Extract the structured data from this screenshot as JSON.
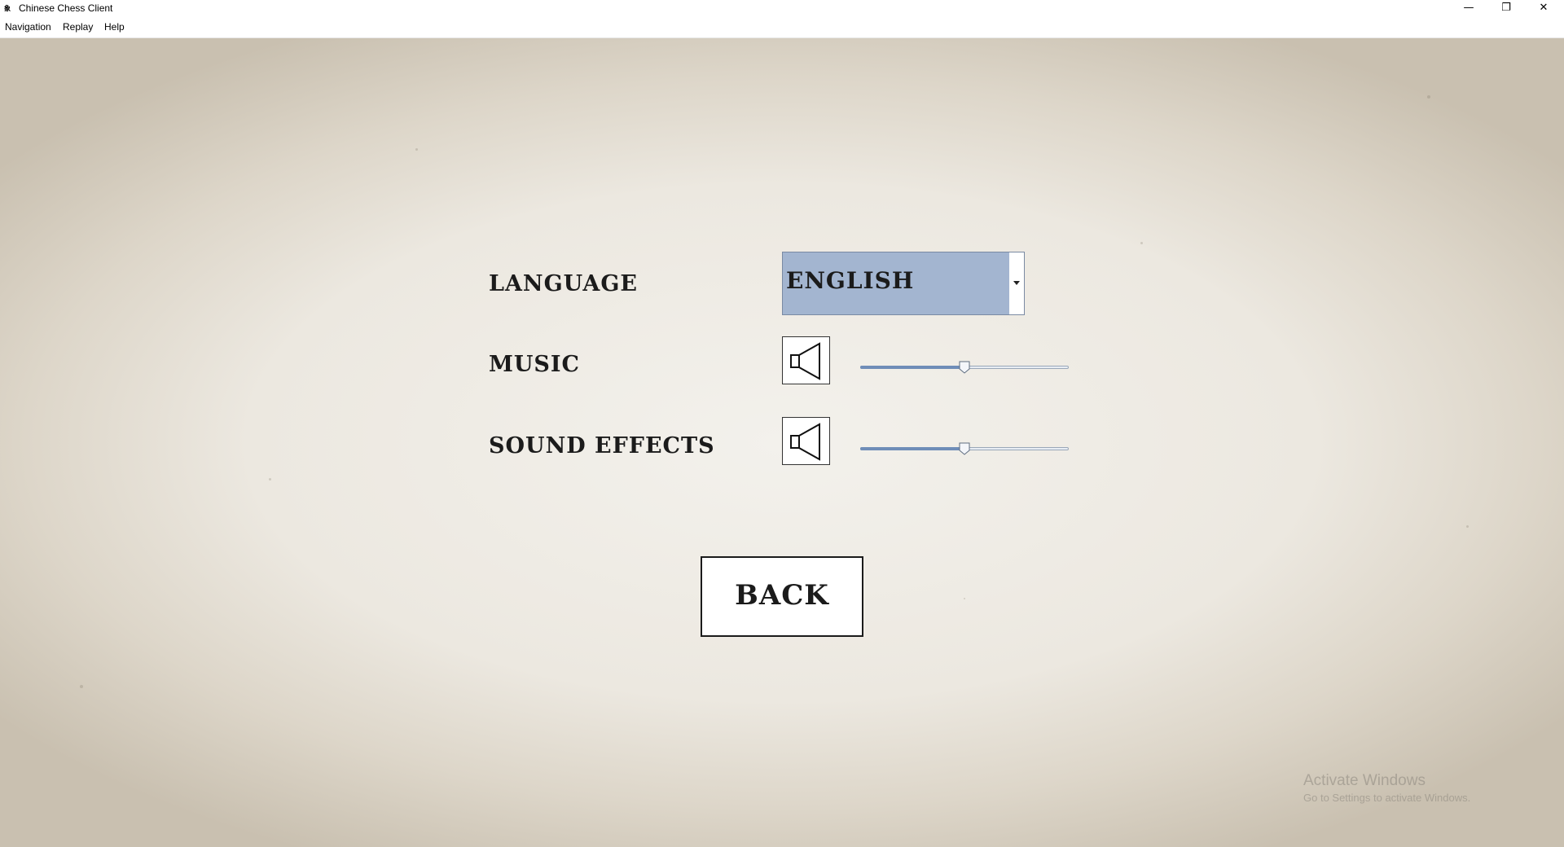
{
  "window": {
    "title": "Chinese Chess Client",
    "icon_text": "象",
    "minimize_symbol": "—",
    "restore_symbol": "❐",
    "close_symbol": "✕"
  },
  "menu": {
    "items": [
      "Navigation",
      "Replay",
      "Help"
    ]
  },
  "settings": {
    "language_label": "LANGUAGE",
    "language_value": "ENGLISH",
    "music_label": "MUSIC",
    "music_volume": 0.5,
    "sound_effects_label": "SOUND EFFECTS",
    "sound_effects_volume": 0.5
  },
  "buttons": {
    "back_label": "BACK"
  },
  "watermark": {
    "line1": "Activate Windows",
    "line2": "Go to Settings to activate Windows."
  },
  "icons": {
    "speaker": "speaker-icon",
    "dropdown": "chevron-down-icon"
  },
  "colors": {
    "dropdown_bg": "#a3b5d0",
    "text": "#1b1b1b",
    "slider_fill": "#6f8db8"
  }
}
